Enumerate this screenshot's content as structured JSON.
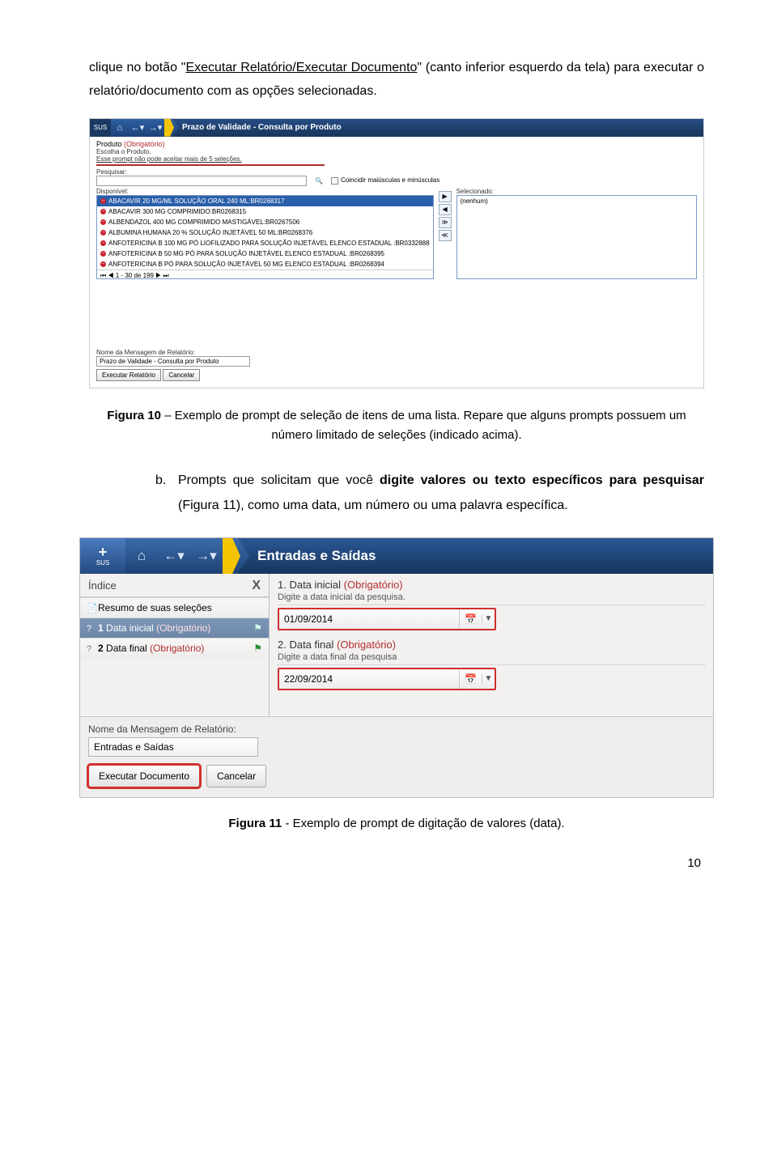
{
  "para1_pre": "clique no botão \"",
  "para1_link": "Executar Relatório/Executar Documento",
  "para1_post": "\" (canto inferior esquerdo da tela) para executar o relatório/documento com as opções selecionadas.",
  "shot1": {
    "sus": "SUS",
    "title": "Prazo de Validade - Consulta por Produto",
    "produto": "Produto",
    "obrig": "(Obrigatório)",
    "escolha": "Escolha o Produto.",
    "limite": "Esse prompt não pode aceitar mais de 5 seleções.",
    "pesquisar": "Pesquisar:",
    "coincidir": "Coincidir maiúsculas e minúsculas",
    "disponivel": "Disponível:",
    "selecionado": "Selecionado:",
    "nenhum": "(nenhum)",
    "items": [
      "ABACAVIR 20 MG/ML SOLUÇÃO ORAL 240 ML:BR0268317",
      "ABACAVIR 300 MG COMPRIMIDO:BR0268315",
      "ALBENDAZOL 400 MG COMPRIMIDO MASTIGÁVEL:BR0267506",
      "ALBUMINA HUMANA 20 % SOLUÇÃO INJETÁVEL 50 ML:BR0268376",
      "ANFOTERICINA B 100 MG PÓ LIOFILIZADO PARA SOLUÇÃO INJETÁVEL ELENCO ESTADUAL :BR0332888",
      "ANFOTERICINA B 50 MG PÓ PARA SOLUÇÃO INJETÁVEL ELENCO ESTADUAL :BR0268395",
      "ANFOTERICINA B PÓ PARA SOLUÇÃO INJETÁVEL 50 MG ELENCO ESTADUAL :BR0268394"
    ],
    "pager": "1 - 30 de 199",
    "nome_msg": "Nome da Mensagem de Relatório:",
    "msg_value": "Prazo de Validade - Consulta por Produto",
    "exec": "Executar Relatório",
    "cancel": "Cancelar"
  },
  "caption1_bold": "Figura 10",
  "caption1_rest": " – Exemplo de prompt de seleção de itens de uma lista. Repare que alguns prompts possuem um número limitado de seleções (indicado acima).",
  "itemb_marker": "b.",
  "itemb_pre": "Prompts que solicitam que você ",
  "itemb_bold": "digite valores ou texto específicos para pesquisar",
  "itemb_post": " (Figura 11), como uma data, um número ou uma palavra específica.",
  "shot2": {
    "sus": "SUS",
    "title": "Entradas e Saídas",
    "indice": "Índice",
    "resumo": "Resumo de suas seleções",
    "r1_num": "1",
    "r1_lbl": "Data inicial",
    "r2_num": "2",
    "r2_lbl": "Data final",
    "obrig": "(Obrigatório)",
    "q1": "1.  Data inicial",
    "q1hint": "Digite a data inicial da pesquisa.",
    "q1val": "01/09/2014",
    "q2": "2.  Data final",
    "q2hint": "Digite a data final da pesquisa",
    "q2val": "22/09/2014",
    "nome_msg": "Nome da Mensagem de Relatório:",
    "msg_value": "Entradas e Saídas",
    "exec": "Executar Documento",
    "cancel": "Cancelar"
  },
  "caption2_bold": "Figura 11",
  "caption2_rest": " - Exemplo de prompt de digitação de valores (data).",
  "pageno": "10"
}
